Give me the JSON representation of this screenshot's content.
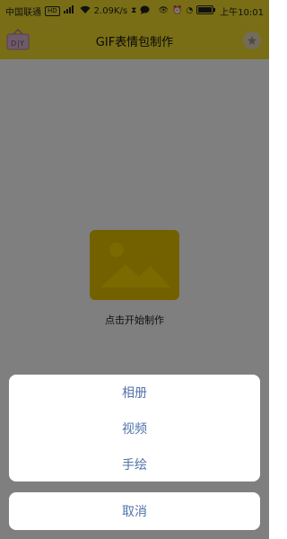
{
  "status_bar": {
    "carrier": "中国联通",
    "hd_badge": "HD",
    "network": "4G",
    "speed": "2.09K/s",
    "battery": "89",
    "time": "上午10:01"
  },
  "app_bar": {
    "title": "GIF表情包制作",
    "logo_text": "DIY"
  },
  "main": {
    "start_label": "点击开始制作"
  },
  "action_sheet": {
    "items": [
      {
        "label": "相册"
      },
      {
        "label": "视频"
      },
      {
        "label": "手绘"
      }
    ],
    "cancel_label": "取消"
  },
  "colors": {
    "primary_yellow": "#f2dd2b",
    "placeholder_yellow": "#e7c200",
    "sheet_text": "#5073a8"
  },
  "icons": [
    "diy-logo-icon",
    "star-icon",
    "image-placeholder-icon",
    "wifi-icon",
    "signal-icon",
    "battery-icon",
    "alarm-icon",
    "eye-icon",
    "message-icon",
    "hourglass-icon"
  ]
}
